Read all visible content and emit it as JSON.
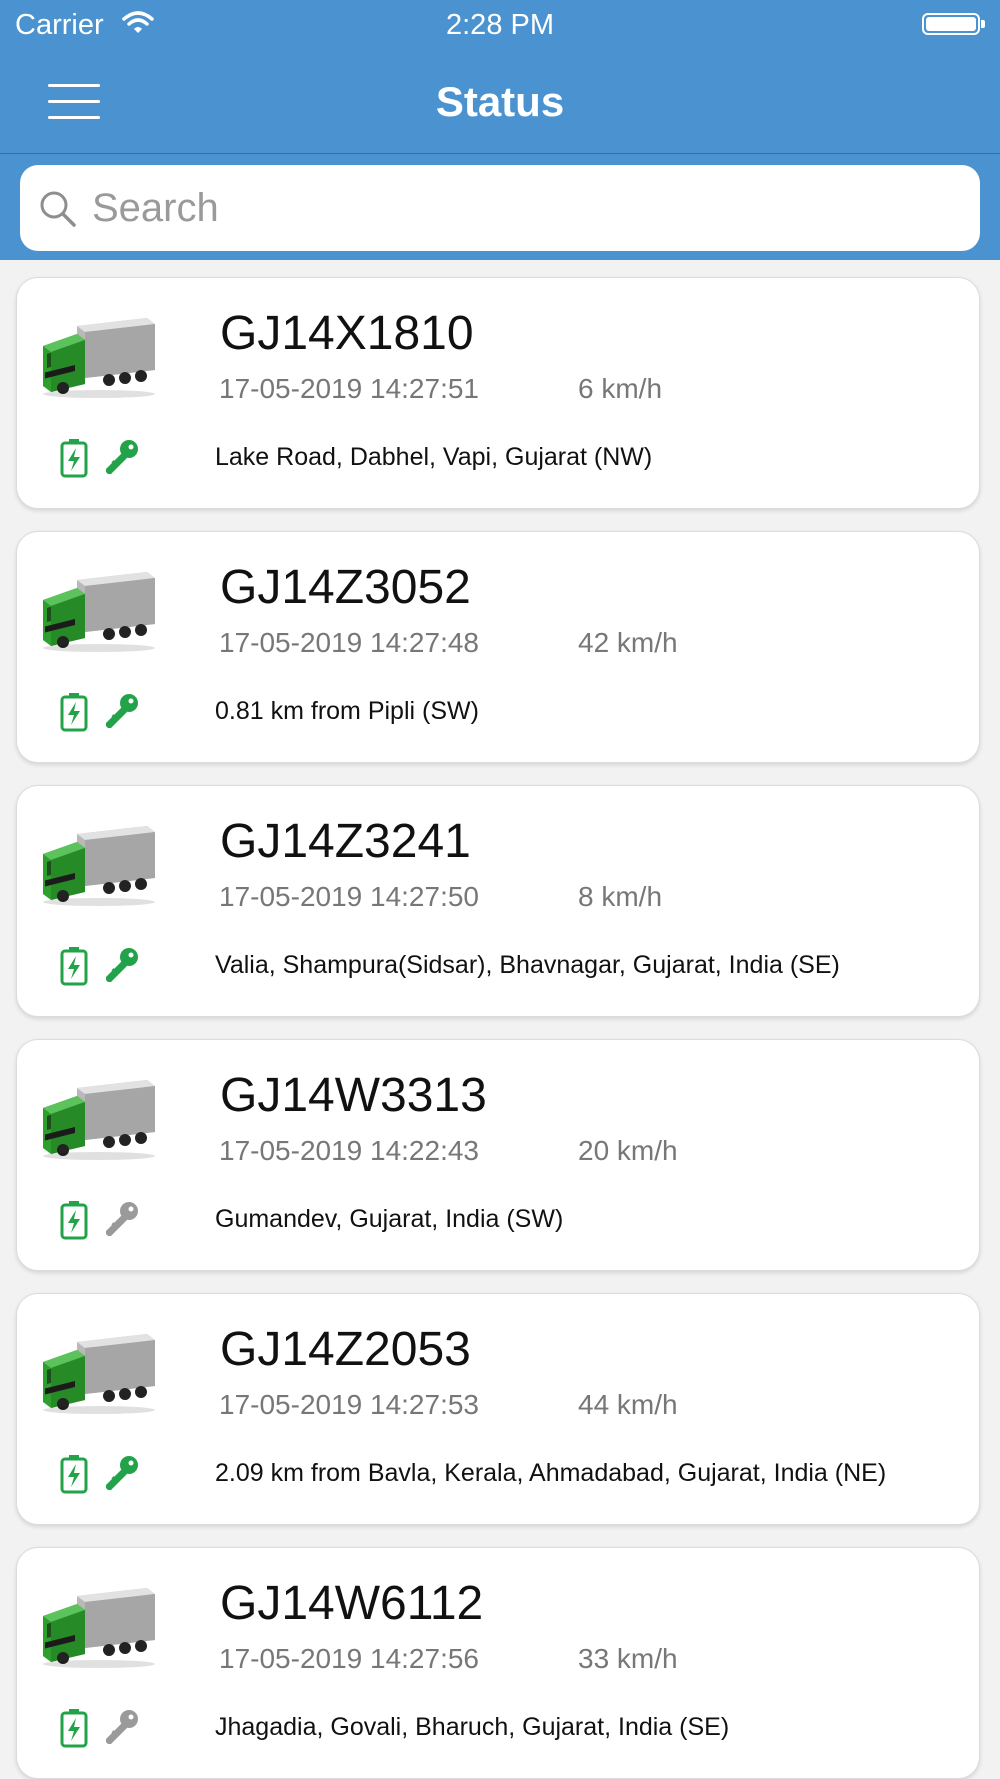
{
  "status_bar": {
    "carrier": "Carrier",
    "time": "2:28 PM"
  },
  "nav": {
    "title": "Status",
    "menu_icon": "hamburger-menu-icon"
  },
  "search": {
    "placeholder": "Search",
    "value": ""
  },
  "colors": {
    "header": "#4a93d0",
    "ignition_on": "#22a34a",
    "ignition_off": "#9a9a9a",
    "battery": "#22a34a",
    "truck": "#2e9e2e"
  },
  "vehicles": [
    {
      "plate": "GJ14X1810",
      "datetime": "17-05-2019 14:27:51",
      "speed": "6 km/h",
      "address": "Lake Road, Dabhel, Vapi, Gujarat (NW)",
      "ignition": "on"
    },
    {
      "plate": "GJ14Z3052",
      "datetime": "17-05-2019 14:27:48",
      "speed": "42 km/h",
      "address": "0.81 km from Pipli (SW)",
      "ignition": "on"
    },
    {
      "plate": "GJ14Z3241",
      "datetime": "17-05-2019 14:27:50",
      "speed": "8 km/h",
      "address": "Valia, Shampura(Sidsar), Bhavnagar, Gujarat, India (SE)",
      "ignition": "on"
    },
    {
      "plate": "GJ14W3313",
      "datetime": "17-05-2019 14:22:43",
      "speed": "20 km/h",
      "address": "Gumandev, Gujarat, India (SW)",
      "ignition": "off"
    },
    {
      "plate": "GJ14Z2053",
      "datetime": "17-05-2019 14:27:53",
      "speed": "44 km/h",
      "address": "2.09 km from Bavla, Kerala, Ahmadabad, Gujarat, India (NE)",
      "ignition": "on"
    },
    {
      "plate": "GJ14W6112",
      "datetime": "17-05-2019 14:27:56",
      "speed": "33 km/h",
      "address": "Jhagadia, Govali, Bharuch, Gujarat, India (SE)",
      "ignition": "off"
    }
  ]
}
